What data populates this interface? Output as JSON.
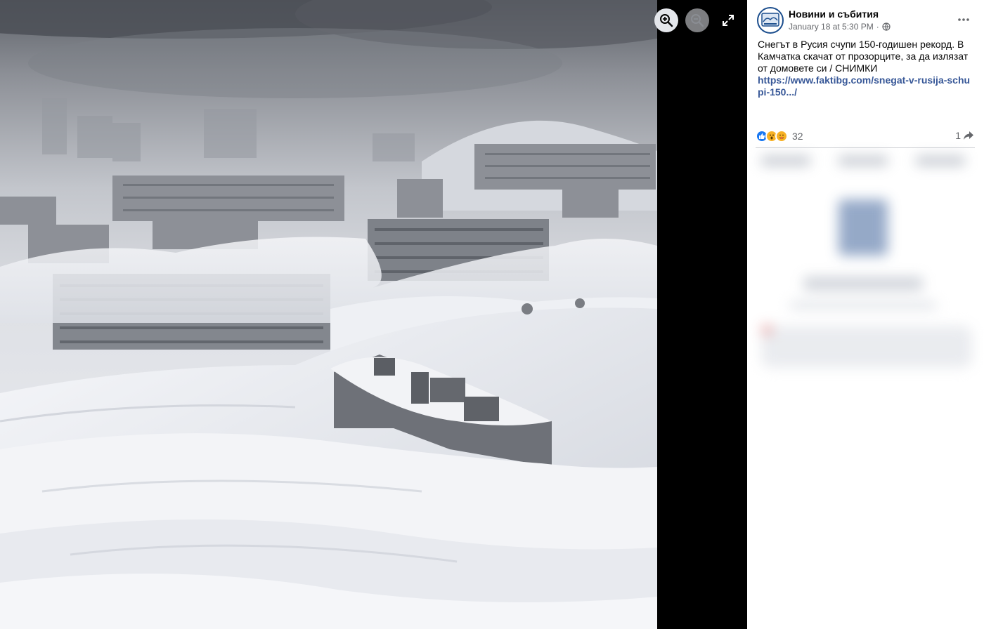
{
  "viewer": {
    "photo_alt": "Snow-covered apartment blocks in Kamchatka",
    "zoom_in_icon": "zoom-in-icon",
    "zoom_out_icon": "zoom-out-icon",
    "fullscreen_icon": "fullscreen-icon"
  },
  "post": {
    "page_name": "Новини и събития",
    "timestamp": "January 18 at 5:30 PM",
    "dot": "·",
    "audience_icon": "globe-icon",
    "more_icon": "more-horizontal-icon",
    "text": "Снегът в Русия счупи 150-годишен рекорд. В Камчатка скачат от прозорците, за да излязат от домовете си / СНИМКИ",
    "link": "https://www.faktibg.com/snegat-v-rusija-schupi-150.../",
    "reaction_icons": [
      "like-icon",
      "wow-icon",
      "care-icon"
    ],
    "reaction_count": "32",
    "share_count": "1",
    "share_icon": "share-arrow-icon"
  },
  "colors": {
    "link": "#385898",
    "like_blue": "#1877f2",
    "wow_yellow": "#f7b125",
    "meta_gray": "#65676b"
  }
}
